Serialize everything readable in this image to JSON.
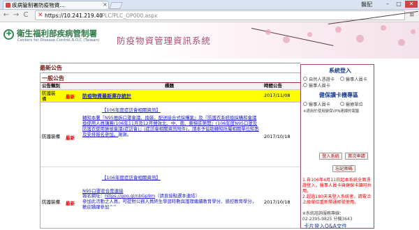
{
  "browser": {
    "tab_title": "疾病管制署防疫物資...",
    "tab_close": "×",
    "profile": "醫配",
    "min": "–",
    "max": "□",
    "close": "✕",
    "back": "←",
    "forward": "→",
    "reload": "C",
    "url_warning": "✕",
    "url_host": "https://10.241.219.40",
    "url_path": "/PLC/PLC_OP000.aspx",
    "menu": "≡"
  },
  "header": {
    "org_name": "衛生福利部疾病管制署",
    "org_en": "Centers for Disease Control,R.O.C (Taiwan)",
    "system_name": "防疫物資管理資訊系統",
    "logo_glyph": "✚"
  },
  "main": {
    "section_title": "最新公告",
    "general_title": "一般公告",
    "headers": {
      "category": "公告類別",
      "title": "標題",
      "time": "時間公告"
    },
    "rows": [
      {
        "category": "防護裝備",
        "new": "最新",
        "title": "防疫物資最新庫存統計",
        "date": "2017/11/08"
      },
      {
        "category": "防護裝備",
        "new": "最新",
        "heading": "【106年度症訪會相關資訊】",
        "body_link": "轉知本署『N95推拆口罩會議、換裝、配送接合式採購案』及『防護衣系統換採購和會議換使用人員講團(106年11月及12月聲效北、中、南、東梯區第開』(106年度N95口罩及防護衣使用勝號會議(症訪會)』(症訪會相關資訊附件)，請本予協助轉知所屬相關單位知悉及安排報名參加。",
        "body_tail": "謝謝。",
        "date": "2017/10/18"
      },
      {
        "category": "防護裝備",
        "new": "最新",
        "heading": "【106年度症訪會相關資訊】",
        "line1": "N95口罩密合度連接",
        "line2_prefix": "報名網址：",
        "line2_url": "https://goo.gl/nbGp9m",
        "line2_suffix": "（請直接點選本連結）",
        "line3": "參加此活動之人員，可提對公務人員終生學習時數與護理繼續教育學分、感控教育學分，歡迎踴躍參加^^",
        "date": "2017/10/18"
      }
    ]
  },
  "sidebar": {
    "login_title": "系統登入",
    "login_options": [
      "自然人憑證卡",
      "醫事人員卡",
      "醫事人員卡"
    ],
    "health_title": "健保讀卡機專區",
    "health_options": [
      "醫事人員卡",
      "醫療單位"
    ],
    "health_note": "※適用於使用健保VPN連線的電腦",
    "btn_login": "登入系統",
    "btn_first": "首次申請",
    "btn_forgot": "忘記密碼",
    "notice_1": "1.自106年4月11日起本系統全面憑證登入，醫事人員卡與健保卡讀可共用。",
    "notice_2": "2.超過180天未登入系統者，請電洽上級單位重新開通帳號使用。",
    "contact_label": "※系統諮詢服務專線：",
    "contact_phone": "02-2395-9825 分機3643",
    "faq_link": "卡片登入Q&A文件"
  },
  "colors": {
    "accent_green": "#2f7a4a",
    "title_pink": "#b04a6a",
    "new_red": "#e00000",
    "link_blue": "#1a1acc",
    "highlight_yellow": "#ffff00"
  }
}
